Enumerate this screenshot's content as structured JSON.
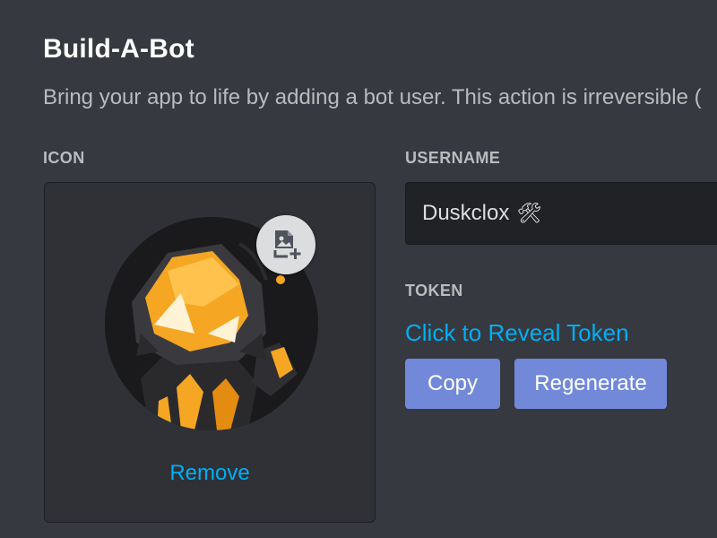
{
  "header": {
    "title": "Build-A-Bot",
    "subtitle": "Bring your app to life by adding a bot user. This action is irreversible ("
  },
  "icon_section": {
    "label": "ICON",
    "remove_label": "Remove",
    "upload_icon": "image-plus-icon"
  },
  "username_section": {
    "label": "USERNAME",
    "value": "Duskclox",
    "emoji": "🛠",
    "emoji_icon": "hammer-and-wrench-icon"
  },
  "token_section": {
    "label": "TOKEN",
    "reveal_label": "Click to Reveal Token",
    "copy_label": "Copy",
    "regenerate_label": "Regenerate"
  },
  "colors": {
    "background": "#36393f",
    "card": "#2f3136",
    "input": "#202225",
    "link": "#00aff4",
    "button": "#7289da",
    "avatar_orange": "#f5a623"
  }
}
